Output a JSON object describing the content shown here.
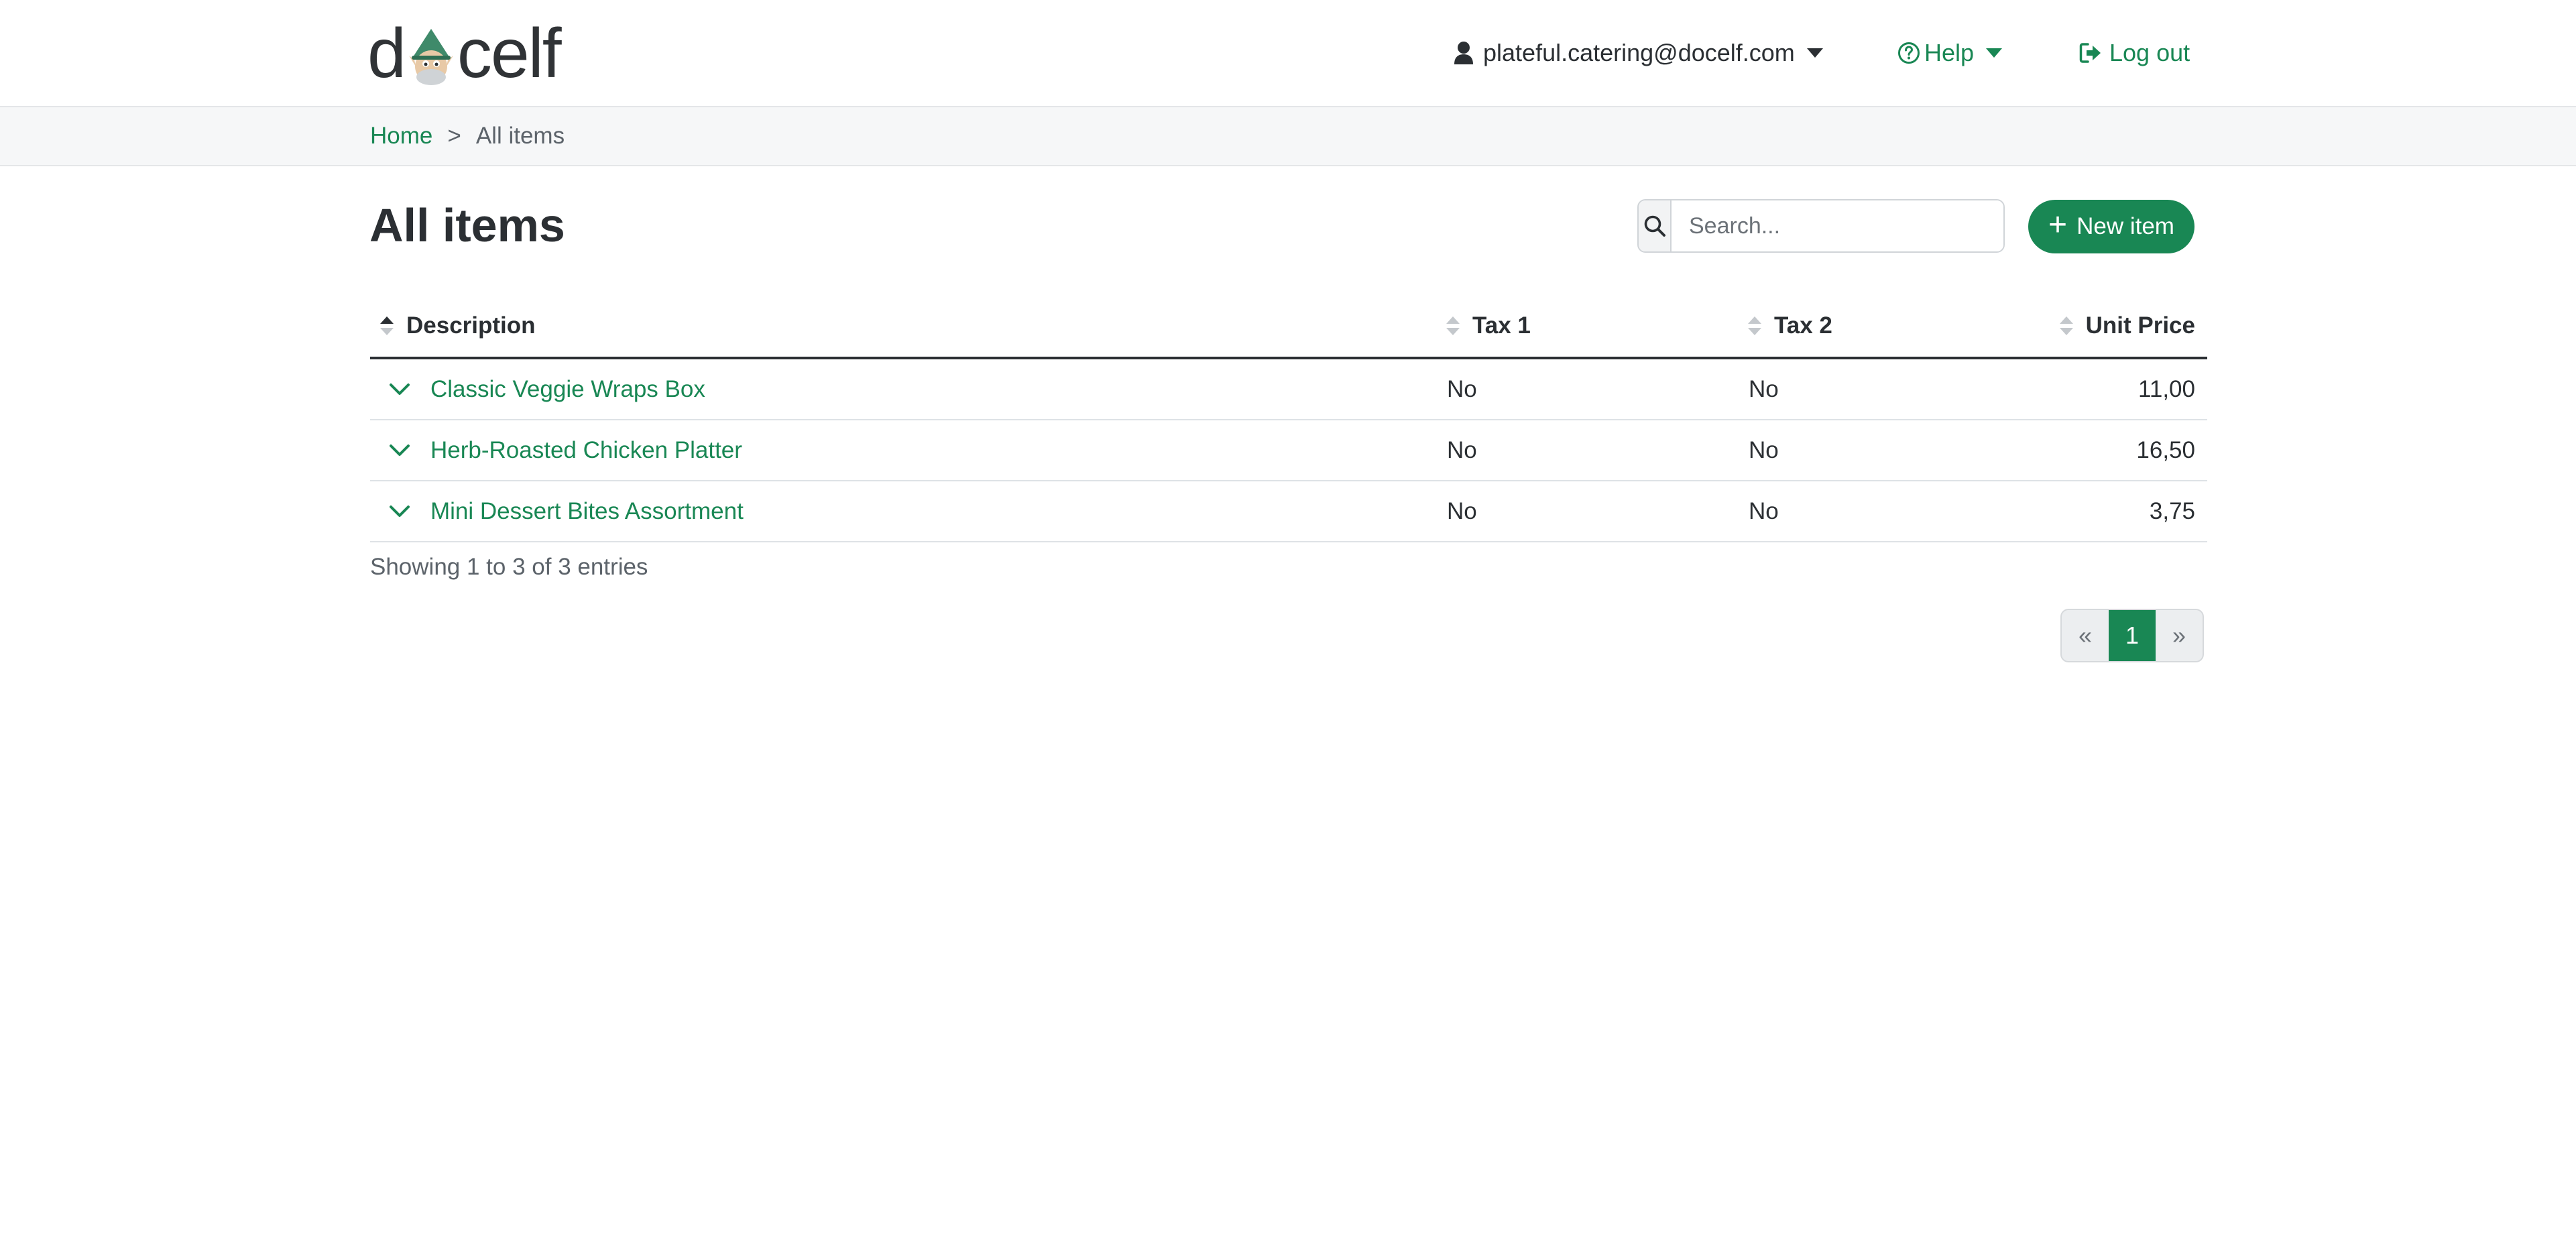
{
  "header": {
    "logo_text_before": "d",
    "logo_text_after": "celf",
    "user_email": "plateful.catering@docelf.com",
    "help_label": "Help",
    "logout_label": "Log out"
  },
  "breadcrumb": {
    "home": "Home",
    "separator": ">",
    "current": "All items"
  },
  "page": {
    "title": "All items",
    "search_placeholder": "Search...",
    "new_item_label": "New item"
  },
  "table": {
    "columns": [
      "Description",
      "Tax 1",
      "Tax 2",
      "Unit Price"
    ],
    "rows": [
      {
        "description": "Classic Veggie Wraps Box",
        "tax1": "No",
        "tax2": "No",
        "unit_price": "11,00"
      },
      {
        "description": "Herb-Roasted Chicken Platter",
        "tax1": "No",
        "tax2": "No",
        "unit_price": "16,50"
      },
      {
        "description": "Mini Dessert Bites Assortment",
        "tax1": "No",
        "tax2": "No",
        "unit_price": "3,75"
      }
    ],
    "info": "Showing 1 to 3 of 3 entries"
  },
  "pagination": {
    "prev": "«",
    "current": "1",
    "next": "»"
  },
  "colors": {
    "accent": "#198754",
    "text": "#2b2f33"
  }
}
